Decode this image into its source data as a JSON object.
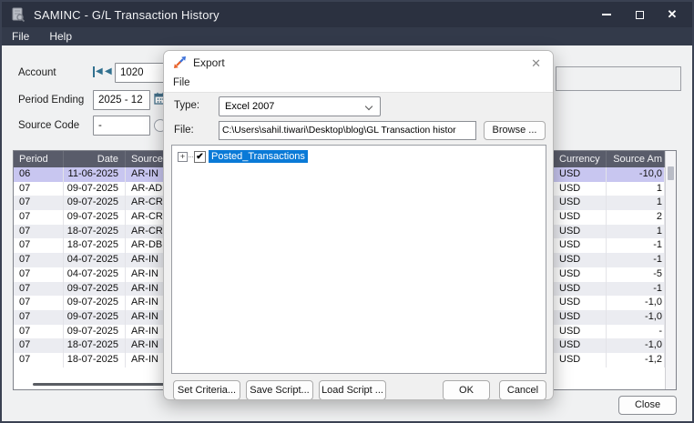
{
  "window": {
    "title": "SAMINC - G/L Transaction History",
    "menu": [
      {
        "label": "File"
      },
      {
        "label": "Help"
      }
    ],
    "controls": {
      "close_glyph": "✕"
    }
  },
  "form": {
    "account_label": "Account",
    "account_value": "1020",
    "period_label": "Period Ending",
    "period_value": "2025 - 12",
    "source_label": "Source Code",
    "source_value": "-",
    "description_value": ""
  },
  "grid": {
    "columns": [
      {
        "label": "Period"
      },
      {
        "label": "Date"
      },
      {
        "label": "Source"
      },
      {
        "label": "Currency"
      },
      {
        "label": "Source Am"
      }
    ],
    "selected_row": 0,
    "rows": [
      [
        "06",
        "11-06-2025",
        "AR-IN",
        "USD",
        "-10,0"
      ],
      [
        "07",
        "09-07-2025",
        "AR-AD",
        "USD",
        "1"
      ],
      [
        "07",
        "09-07-2025",
        "AR-CR",
        "USD",
        "1"
      ],
      [
        "07",
        "09-07-2025",
        "AR-CR",
        "USD",
        "2"
      ],
      [
        "07",
        "18-07-2025",
        "AR-CR",
        "USD",
        "1"
      ],
      [
        "07",
        "18-07-2025",
        "AR-DB",
        "USD",
        "-1"
      ],
      [
        "07",
        "04-07-2025",
        "AR-IN",
        "USD",
        "-1"
      ],
      [
        "07",
        "04-07-2025",
        "AR-IN",
        "USD",
        "-5"
      ],
      [
        "07",
        "09-07-2025",
        "AR-IN",
        "USD",
        "-1"
      ],
      [
        "07",
        "09-07-2025",
        "AR-IN",
        "USD",
        "-1,0"
      ],
      [
        "07",
        "09-07-2025",
        "AR-IN",
        "USD",
        "-1,0"
      ],
      [
        "07",
        "09-07-2025",
        "AR-IN",
        "USD",
        "-"
      ],
      [
        "07",
        "18-07-2025",
        "AR-IN",
        "USD",
        "-1,0"
      ],
      [
        "07",
        "18-07-2025",
        "AR-IN",
        "USD",
        "-1,2"
      ]
    ]
  },
  "dialog": {
    "title": "Export",
    "close_glyph": "✕",
    "menu": [
      {
        "label": "File"
      }
    ],
    "type_label": "Type:",
    "type_value": "Excel 2007",
    "file_label": "File:",
    "file_value": "C:\\Users\\sahil.tiwari\\Desktop\\blog\\GL Transaction histor",
    "browse_label": "Browse ...",
    "tree": {
      "expand_glyph": "+",
      "check_glyph": "✔",
      "node_label": "Posted_Transactions",
      "checked": true
    },
    "buttons": {
      "set_criteria": "Set Criteria...",
      "save_script": "Save Script...",
      "load_script": "Load Script ...",
      "ok": "OK",
      "cancel": "Cancel"
    }
  },
  "footer": {
    "close_label": "Close"
  },
  "colors": {
    "titlebar": "#2b3140",
    "menubar": "#333a4a",
    "grid_header": "#595c6a",
    "selected_row": "#c8c6f0",
    "tree_selection": "#0a7ad7",
    "nav_arrow": "#31708f"
  }
}
